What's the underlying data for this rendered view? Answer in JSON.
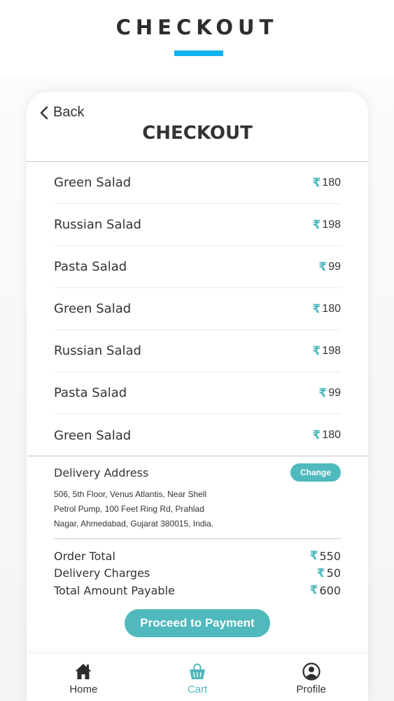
{
  "banner": {
    "title": "CHECKOUT"
  },
  "header": {
    "back_label": "Back",
    "title": "CHECKOUT"
  },
  "cart": {
    "currency_symbol": "₹",
    "items": [
      {
        "name": "Green Salad",
        "price": "180"
      },
      {
        "name": "Russian Salad",
        "price": "198"
      },
      {
        "name": "Pasta Salad",
        "price": " 99"
      },
      {
        "name": "Green Salad",
        "price": "180"
      },
      {
        "name": "Russian Salad",
        "price": "198"
      },
      {
        "name": "Pasta Salad",
        "price": " 99"
      },
      {
        "name": "Green Salad",
        "price": "180"
      }
    ]
  },
  "delivery": {
    "title": "Delivery Address",
    "change_label": "Change",
    "address_lines": [
      "506, 5th Floor, Venus Atlantis, Near Shell",
      "Petrol Pump, 100 Feet Ring Rd, Prahlad",
      "Nagar, Ahmedabad, Gujarat 380015, India."
    ]
  },
  "totals": {
    "order_total_label": "Order Total",
    "order_total_value": "550",
    "delivery_label": "Delivery Charges",
    "delivery_value": " 50",
    "payable_label": "Total Amount Payable",
    "payable_value": "600"
  },
  "proceed_label": "Proceed to Payment",
  "nav": {
    "home_label": "Home",
    "cart_label": "Cart",
    "profile_label": "Profile",
    "active": "cart"
  },
  "colors": {
    "accent": "#4fb9bd",
    "banner_bar": "#11b4ee",
    "text": "#333333"
  },
  "icons": {
    "back": "chevron-left-icon",
    "home": "home-icon",
    "cart": "shopping-bag-icon",
    "profile": "user-icon"
  }
}
